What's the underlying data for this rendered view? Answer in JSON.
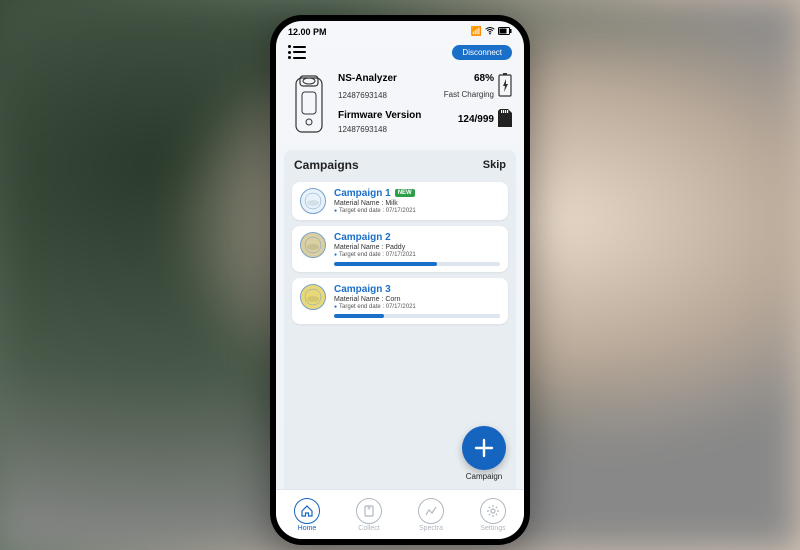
{
  "status": {
    "time": "12.00 PM"
  },
  "topbar": {
    "disconnect": "Disconnect"
  },
  "device": {
    "name": "NS-Analyzer",
    "serial": "12487693148",
    "battery_pct": "68%",
    "battery_status": "Fast Charging",
    "firmware_label": "Firmware Version",
    "firmware_value": "12487693148",
    "storage": "124/999"
  },
  "campaigns": {
    "title": "Campaigns",
    "skip": "Skip",
    "items": [
      {
        "title": "Campaign 1",
        "new_badge": "NEW",
        "material_line": "Material Name : Milk",
        "meta": "Target end date : 07/17/2021",
        "progress_pct": 0,
        "avatar_bg": "#e8f2fa"
      },
      {
        "title": "Campaign 2",
        "new_badge": "",
        "material_line": "Material Name : Paddy",
        "meta": "Target end date : 07/17/2021",
        "progress_pct": 62,
        "avatar_bg": "#d9cfa0"
      },
      {
        "title": "Campaign 3",
        "new_badge": "",
        "material_line": "Material Name : Corn",
        "meta": "Target end date : 07/17/2021",
        "progress_pct": 30,
        "avatar_bg": "#e8d87a"
      }
    ]
  },
  "fab": {
    "label": "Campaign"
  },
  "nav": {
    "items": [
      {
        "label": "Home"
      },
      {
        "label": "Collect"
      },
      {
        "label": "Spectra"
      },
      {
        "label": "Settings"
      }
    ]
  }
}
